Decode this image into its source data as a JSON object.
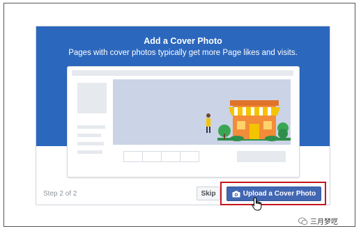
{
  "dialog": {
    "title": "Add a Cover Photo",
    "subtitle": "Pages with cover photos typically get more Page likes and visits.",
    "step": "Step 2 of 2",
    "skip_label": "Skip",
    "upload_label": "Upload a Cover Photo"
  },
  "watermark": {
    "text": "三月梦呓"
  },
  "colors": {
    "banner": "#2b67bd",
    "upload_button": "#4267b2",
    "highlight_border": "#c4161c",
    "illustration_cover": "#cbd3e6",
    "store_roof": "#f28c38",
    "store_awning": "#f5c400",
    "tree": "#3aa655"
  },
  "icons": {
    "camera": "camera-icon",
    "cursor": "hand-pointer-icon",
    "watermark": "wechat-icon"
  }
}
